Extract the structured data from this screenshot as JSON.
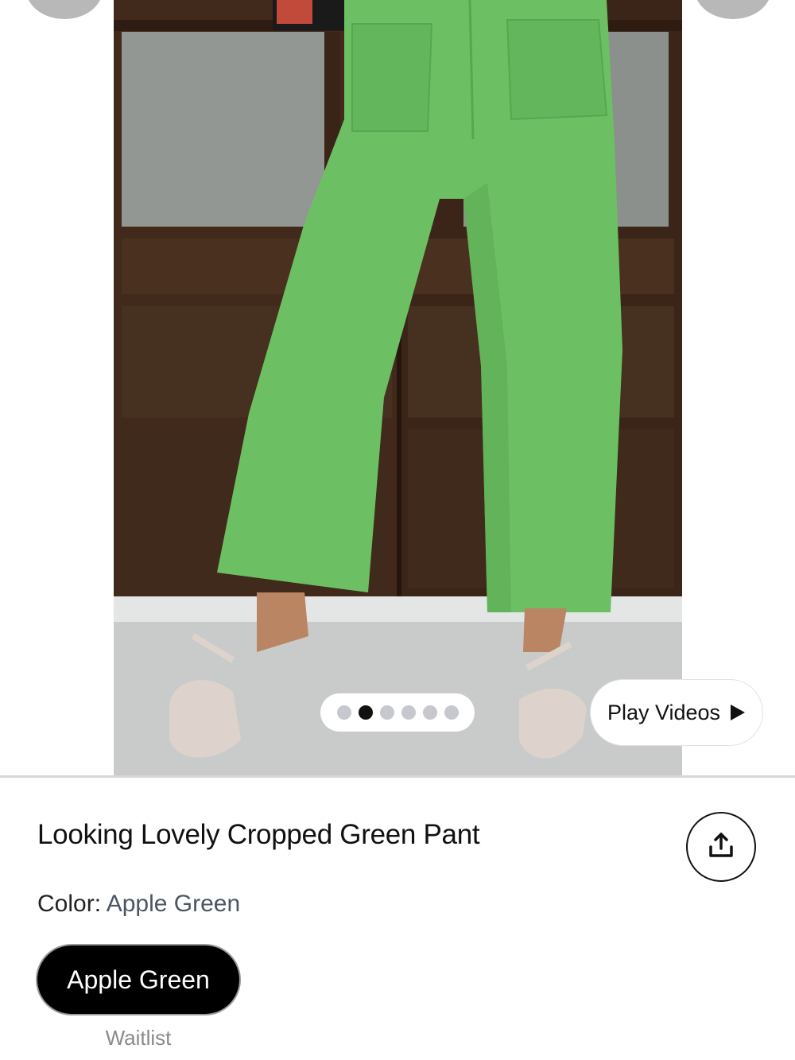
{
  "gallery": {
    "slide_count": 6,
    "active_slide": 2,
    "play_videos_label": "Play Videos",
    "play_icon": "play-triangle-icon"
  },
  "product": {
    "title": "Looking Lovely Cropped Green Pant",
    "color_label": "Color:",
    "color_value": "Apple Green",
    "swatch_label": "Apple Green",
    "waitlist_label": "Waitlist",
    "share_icon": "share-icon"
  },
  "colors": {
    "pant_green": "#6cc063",
    "door_wood": "#3a2418",
    "swatch_bg": "#000000"
  }
}
